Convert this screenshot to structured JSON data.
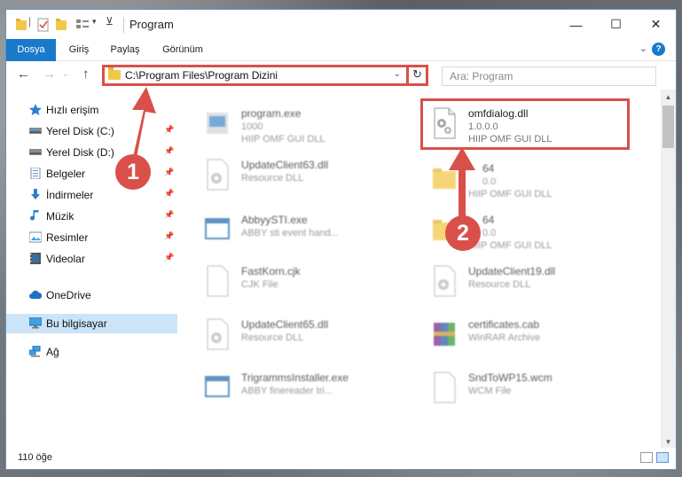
{
  "window": {
    "title": "Program"
  },
  "ribbon": {
    "tabs": [
      "Dosya",
      "Giriş",
      "Paylaş",
      "Görünüm"
    ]
  },
  "address": {
    "path": "C:\\Program Files\\Program Dizini"
  },
  "search": {
    "placeholder": "Ara: Program"
  },
  "nav_pane": {
    "items": [
      {
        "label": "Hızlı erişim",
        "icon": "star-icon"
      },
      {
        "label": "Yerel Disk (C:)",
        "icon": "drive-icon",
        "pinned": true
      },
      {
        "label": "Yerel Disk (D:)",
        "icon": "drive-icon",
        "pinned": true
      },
      {
        "label": "Belgeler",
        "icon": "documents-icon",
        "pinned": true
      },
      {
        "label": "İndirmeler",
        "icon": "download-icon",
        "pinned": true
      },
      {
        "label": "Müzik",
        "icon": "music-icon",
        "pinned": true
      },
      {
        "label": "Resimler",
        "icon": "pictures-icon",
        "pinned": true
      },
      {
        "label": "Videolar",
        "icon": "video-icon",
        "pinned": true
      },
      {
        "label": "OneDrive",
        "icon": "cloud-icon"
      },
      {
        "label": "Bu bilgisayar",
        "icon": "computer-icon",
        "selected": true
      },
      {
        "label": "Ağ",
        "icon": "network-icon"
      }
    ]
  },
  "files": {
    "left": [
      {
        "name": "program.exe",
        "line1": "1000",
        "line2": "HIIP OMF GUI DLL",
        "icon": "exe-icon"
      },
      {
        "name": "UpdateClient63.dll",
        "line1": "Resource DLL",
        "icon": "dll-icon"
      },
      {
        "name": "AbbyySTI.exe",
        "line1": "ABBY sti event hand...",
        "icon": "window-icon"
      },
      {
        "name": "FastKorn.cjk",
        "line1": "CJK File",
        "icon": "blank-file-icon"
      },
      {
        "name": "UpdateClient65.dll",
        "line1": "Resource DLL",
        "icon": "dll-icon"
      },
      {
        "name": "TrigrammsInstaller.exe",
        "line1": "ABBY finereader tri...",
        "icon": "window-icon"
      }
    ],
    "right": [
      {
        "name": "omfdialog.dll",
        "line1": "1.0.0.0",
        "line2": "HIIP OMF GUI DLL",
        "icon": "dll-icon",
        "highlighted": true
      },
      {
        "name": "64",
        "line1": "0.0",
        "line2": "HIIP OMF GUI DLL",
        "icon": "folder-icon"
      },
      {
        "name": "64",
        "line1": "0.0",
        "line2": "HIIP OMF GUI DLL",
        "icon": "folder-icon"
      },
      {
        "name": "UpdateClient19.dll",
        "line1": "Resource DLL",
        "icon": "dll-icon"
      },
      {
        "name": "certificates.cab",
        "line1": "WinRAR Archive",
        "icon": "archive-icon"
      },
      {
        "name": "SndToWP15.wcm",
        "line1": "WCM File",
        "icon": "blank-file-icon"
      }
    ]
  },
  "status": {
    "count": "110 öğe"
  },
  "annotations": {
    "step1": "1",
    "step2": "2",
    "color": "#d9504a"
  }
}
